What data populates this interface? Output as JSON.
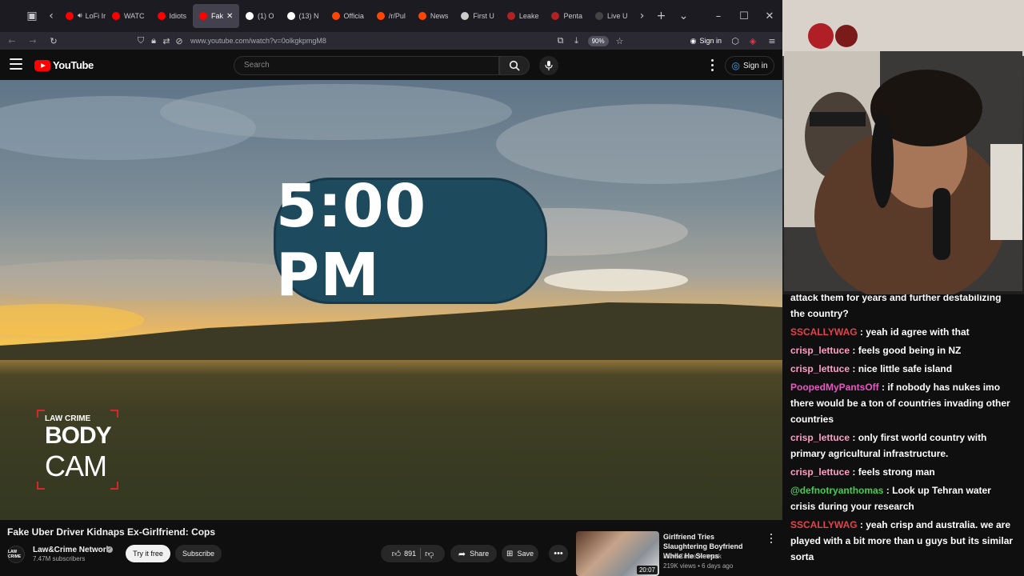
{
  "browser": {
    "tabs": [
      {
        "label": "LoFi Ir",
        "favicon_color": "#ff0000",
        "audio": true
      },
      {
        "label": "WATC",
        "favicon_color": "#ff0000"
      },
      {
        "label": "Idiots",
        "favicon_color": "#ff0000"
      },
      {
        "label": "Fak",
        "favicon_color": "#ff0000",
        "active": true
      },
      {
        "label": "(1) O",
        "favicon_color": "#ffffff"
      },
      {
        "label": "(13) N",
        "favicon_color": "#ffffff"
      },
      {
        "label": "Officia",
        "favicon_color": "#ff4500"
      },
      {
        "label": "/r/Pul",
        "favicon_color": "#ff4500"
      },
      {
        "label": "News",
        "favicon_color": "#ff4500"
      },
      {
        "label": "First U",
        "favicon_color": "#cccccc"
      },
      {
        "label": "Leake",
        "favicon_color": "#b22222"
      },
      {
        "label": "Penta",
        "favicon_color": "#b22222"
      },
      {
        "label": "Live U",
        "favicon_color": "#444444"
      }
    ],
    "url": "www.youtube.com/watch?v=0olkgkpmgM8",
    "zoom": "90%",
    "signin_label": "Sign in"
  },
  "youtube": {
    "logo_text": "YouTube",
    "search_placeholder": "Search",
    "signin_label": "Sign in"
  },
  "video": {
    "overlay_time": "5:00 PM",
    "brand_small": "LAW  CRIME",
    "brand_line1": "BODY",
    "brand_line2": "CAM",
    "title": "Fake Uber Driver Kidnaps Ex-Girlfriend: Cops"
  },
  "channel": {
    "avatar_text": "LAW CRIME",
    "name": "Law&Crime Network",
    "subscribers": "7.47M subscribers",
    "try_label": "Try it free",
    "subscribe_label": "Subscribe"
  },
  "actions": {
    "likes": "891",
    "share_label": "Share",
    "save_label": "Save"
  },
  "recommendation": {
    "title": "Girlfriend Tries Slaughtering Boyfriend While He Sleeps",
    "channel": "Law&Crime Network",
    "meta": "219K views • 6 days ago",
    "duration": "20:07"
  },
  "chat": [
    {
      "user": "",
      "message": "attack them for years and further destabilizing the country?",
      "color": "#ffffff"
    },
    {
      "user": "SSCALLYWAG",
      "message": ": yeah id agree with that",
      "color": "#e6424a"
    },
    {
      "user": "crisp_lettuce",
      "message": ": feels good being in NZ",
      "color": "#ff9fc4"
    },
    {
      "user": "crisp_lettuce",
      "message": ": nice little safe island",
      "color": "#ff9fc4"
    },
    {
      "user": "PoopedMyPantsOff",
      "message": ": if nobody has nukes imo there would be a ton of countries invading other countries",
      "color": "#e35bc0"
    },
    {
      "user": "crisp_lettuce",
      "message": ": only first world country with primary agricultural infrastructure.",
      "color": "#ff9fc4"
    },
    {
      "user": "crisp_lettuce",
      "message": ": feels strong man",
      "color": "#ff9fc4"
    },
    {
      "user": "@defnotryanthomas",
      "message": ": Look up Tehran water crisis during your research",
      "color": "#40d14a"
    },
    {
      "user": "SSCALLYWAG",
      "message": ": yeah crisp and australia. we are played with a bit more than u guys but its similar sorta",
      "color": "#e6424a"
    }
  ]
}
